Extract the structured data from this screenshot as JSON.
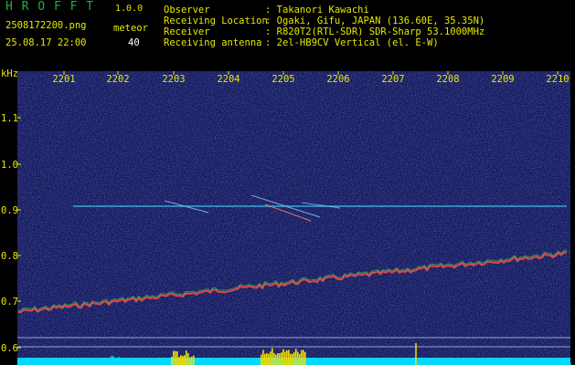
{
  "app": {
    "title": "H R O F F T",
    "version": "1.0.0"
  },
  "file": {
    "name": "2508172200.png",
    "datetime": "25.08.17 22:00"
  },
  "meteor": {
    "label": "meteor",
    "count": "40"
  },
  "info": [
    {
      "label": "Observer",
      "value": ": Takanori Kawachi"
    },
    {
      "label": "Receiving Location",
      "value": ": Ogaki, Gifu, JAPAN (136.60E, 35.35N)"
    },
    {
      "label": "Receiver",
      "value": ": R820T2(RTL-SDR) SDR-Sharp 53.1000MHz"
    },
    {
      "label": "Receiving antenna",
      "value": ": 2el-HB9CV Vertical (el. E-W)"
    }
  ],
  "spectrogram": {
    "unit_label": "kHz",
    "time_ticks": [
      "2201",
      "2202",
      "2203",
      "2204",
      "2205",
      "2206",
      "2207",
      "2208",
      "2209",
      "2210"
    ],
    "freq_ticks": [
      "1.1",
      "1.0",
      "0.9",
      "0.8",
      "0.7",
      "0.6"
    ],
    "colors": {
      "background": "#141a5a",
      "axis": "#e8e800",
      "echo": "#ff5040",
      "carrier": "#40d0ff",
      "level": "#00d8ff",
      "level_peak": "#f0e000"
    }
  }
}
